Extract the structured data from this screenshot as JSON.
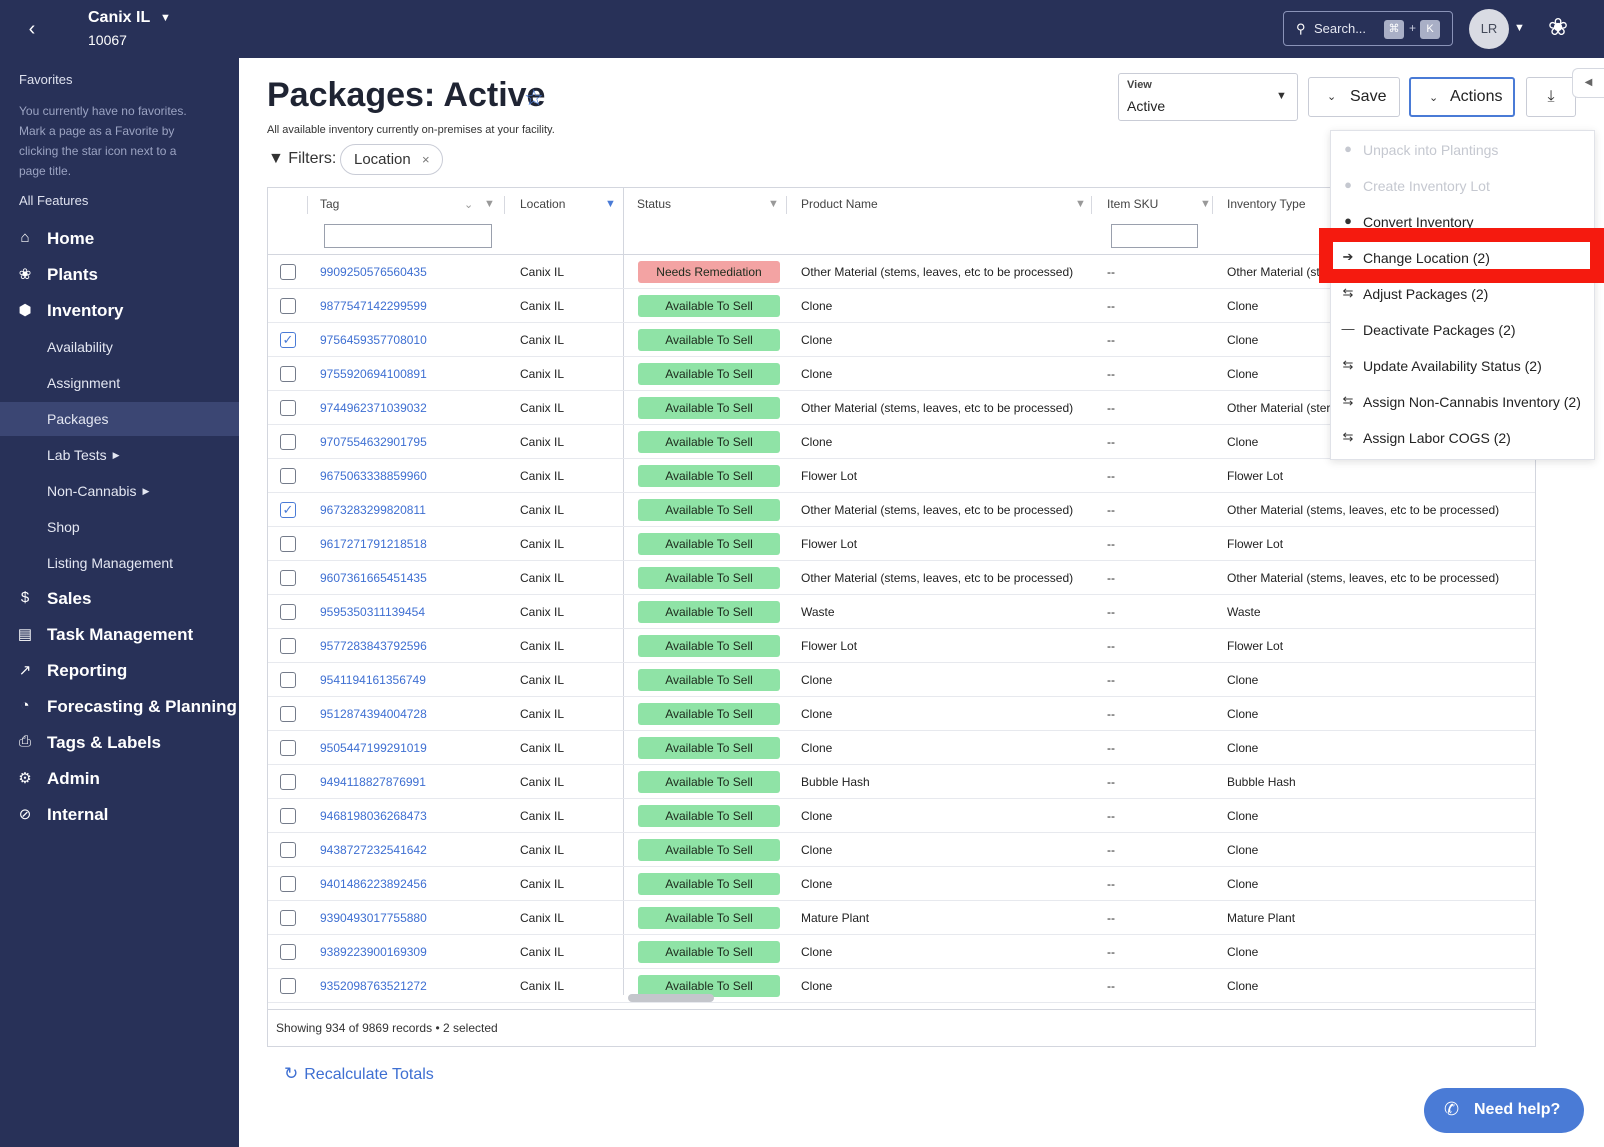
{
  "topbar": {
    "facility_name": "Canix IL",
    "facility_id": "10067",
    "search_placeholder": "Search...",
    "shortcut_keys": [
      "⌘",
      "K"
    ],
    "shortcut_plus": "+",
    "avatar_initials": "LR"
  },
  "sidebar": {
    "favorites_heading": "Favorites",
    "favorites_note": "You currently have no favorites. Mark a page as a Favorite by clicking the star icon next to a page title.",
    "all_features_heading": "All Features",
    "items": [
      {
        "label": "Home",
        "icon": "home-icon",
        "sub": false
      },
      {
        "label": "Plants",
        "icon": "leaf-icon",
        "sub": false
      },
      {
        "label": "Inventory",
        "icon": "box-icon",
        "sub": false
      },
      {
        "label": "Availability",
        "sub": true
      },
      {
        "label": "Assignment",
        "sub": true
      },
      {
        "label": "Packages",
        "sub": true,
        "active": true
      },
      {
        "label": "Lab Tests",
        "sub": true,
        "arrow": true
      },
      {
        "label": "Non-Cannabis",
        "sub": true,
        "arrow": true
      },
      {
        "label": "Shop",
        "sub": true
      },
      {
        "label": "Listing Management",
        "sub": true
      },
      {
        "label": "Sales",
        "icon": "dollar-icon",
        "sub": false
      },
      {
        "label": "Task Management",
        "icon": "clipboard-icon",
        "sub": false
      },
      {
        "label": "Reporting",
        "icon": "trend-icon",
        "sub": false
      },
      {
        "label": "Forecasting & Planning",
        "icon": "clock-icon",
        "sub": false
      },
      {
        "label": "Tags & Labels",
        "icon": "printer-icon",
        "sub": false
      },
      {
        "label": "Admin",
        "icon": "gear-icon",
        "sub": false
      },
      {
        "label": "Internal",
        "icon": "eye-slash-icon",
        "sub": false
      }
    ]
  },
  "page": {
    "title": "Packages: Active",
    "subtitle": "All available inventory currently on-premises at your facility.",
    "filters_label": "Filters:",
    "filter_chip": "Location",
    "view_label": "View",
    "view_value": "Active",
    "save_label": "Save",
    "actions_label": "Actions",
    "recalc_label": "Recalculate Totals",
    "help_label": "Need help?"
  },
  "table": {
    "columns": [
      "Tag",
      "Location",
      "Status",
      "Product Name",
      "Item SKU",
      "Inventory Type"
    ],
    "rows": [
      {
        "tag": "9909250576560435",
        "location": "Canix IL",
        "status": "Needs Remediation",
        "product": "Other Material (stems, leaves, etc to be processed)",
        "sku": "--",
        "type": "Other Material (ste",
        "checked": false
      },
      {
        "tag": "9877547142299599",
        "location": "Canix IL",
        "status": "Available To Sell",
        "product": "Clone",
        "sku": "--",
        "type": "Clone",
        "checked": false
      },
      {
        "tag": "9756459357708010",
        "location": "Canix IL",
        "status": "Available To Sell",
        "product": "Clone",
        "sku": "--",
        "type": "Clone",
        "checked": true
      },
      {
        "tag": "9755920694100891",
        "location": "Canix IL",
        "status": "Available To Sell",
        "product": "Clone",
        "sku": "--",
        "type": "Clone",
        "checked": false
      },
      {
        "tag": "9744962371039032",
        "location": "Canix IL",
        "status": "Available To Sell",
        "product": "Other Material (stems, leaves, etc to be processed)",
        "sku": "--",
        "type": "Other Material (ster",
        "checked": false
      },
      {
        "tag": "9707554632901795",
        "location": "Canix IL",
        "status": "Available To Sell",
        "product": "Clone",
        "sku": "--",
        "type": "Clone",
        "checked": false
      },
      {
        "tag": "9675063338859960",
        "location": "Canix IL",
        "status": "Available To Sell",
        "product": "Flower Lot",
        "sku": "--",
        "type": "Flower Lot",
        "checked": false
      },
      {
        "tag": "9673283299820811",
        "location": "Canix IL",
        "status": "Available To Sell",
        "product": "Other Material (stems, leaves, etc to be processed)",
        "sku": "--",
        "type": "Other Material (stems, leaves, etc to be processed)",
        "checked": true
      },
      {
        "tag": "9617271791218518",
        "location": "Canix IL",
        "status": "Available To Sell",
        "product": "Flower Lot",
        "sku": "--",
        "type": "Flower Lot",
        "checked": false
      },
      {
        "tag": "9607361665451435",
        "location": "Canix IL",
        "status": "Available To Sell",
        "product": "Other Material (stems, leaves, etc to be processed)",
        "sku": "--",
        "type": "Other Material (stems, leaves, etc to be processed)",
        "checked": false
      },
      {
        "tag": "9595350311139454",
        "location": "Canix IL",
        "status": "Available To Sell",
        "product": "Waste",
        "sku": "--",
        "type": "Waste",
        "checked": false
      },
      {
        "tag": "9577283843792596",
        "location": "Canix IL",
        "status": "Available To Sell",
        "product": "Flower Lot",
        "sku": "--",
        "type": "Flower Lot",
        "checked": false
      },
      {
        "tag": "9541194161356749",
        "location": "Canix IL",
        "status": "Available To Sell",
        "product": "Clone",
        "sku": "--",
        "type": "Clone",
        "checked": false
      },
      {
        "tag": "9512874394004728",
        "location": "Canix IL",
        "status": "Available To Sell",
        "product": "Clone",
        "sku": "--",
        "type": "Clone",
        "checked": false
      },
      {
        "tag": "9505447199291019",
        "location": "Canix IL",
        "status": "Available To Sell",
        "product": "Clone",
        "sku": "--",
        "type": "Clone",
        "checked": false
      },
      {
        "tag": "9494118827876991",
        "location": "Canix IL",
        "status": "Available To Sell",
        "product": "Bubble Hash",
        "sku": "--",
        "type": "Bubble Hash",
        "checked": false
      },
      {
        "tag": "9468198036268473",
        "location": "Canix IL",
        "status": "Available To Sell",
        "product": "Clone",
        "sku": "--",
        "type": "Clone",
        "checked": false
      },
      {
        "tag": "9438727232541642",
        "location": "Canix IL",
        "status": "Available To Sell",
        "product": "Clone",
        "sku": "--",
        "type": "Clone",
        "checked": false
      },
      {
        "tag": "9401486223892456",
        "location": "Canix IL",
        "status": "Available To Sell",
        "product": "Clone",
        "sku": "--",
        "type": "Clone",
        "checked": false
      },
      {
        "tag": "9390493017755880",
        "location": "Canix IL",
        "status": "Available To Sell",
        "product": "Mature Plant",
        "sku": "--",
        "type": "Mature Plant",
        "checked": false
      },
      {
        "tag": "9389223900169309",
        "location": "Canix IL",
        "status": "Available To Sell",
        "product": "Clone",
        "sku": "--",
        "type": "Clone",
        "checked": false
      },
      {
        "tag": "9352098763521272",
        "location": "Canix IL",
        "status": "Available To Sell",
        "product": "Clone",
        "sku": "--",
        "type": "Clone",
        "checked": false
      }
    ],
    "footer": "Showing 934 of 9869 records • 2 selected"
  },
  "actions_menu": {
    "items": [
      {
        "label": "Unpack into Plantings",
        "icon": "unpack-icon",
        "disabled": true
      },
      {
        "label": "Create Inventory Lot",
        "icon": "lot-icon",
        "disabled": true
      },
      {
        "label": "Convert Inventory",
        "icon": "convert-icon",
        "disabled": false
      },
      {
        "label": "Change Location (2)",
        "icon": "arrow-right-icon",
        "disabled": false,
        "highlighted": true
      },
      {
        "label": "Adjust Packages (2)",
        "icon": "swap-icon",
        "disabled": false
      },
      {
        "label": "Deactivate Packages (2)",
        "icon": "minus-icon",
        "disabled": false
      },
      {
        "label": "Update Availability Status (2)",
        "icon": "swap-icon",
        "disabled": false
      },
      {
        "label": "Assign Non-Cannabis Inventory (2)",
        "icon": "swap-icon",
        "disabled": false
      },
      {
        "label": "Assign Labor COGS (2)",
        "icon": "swap-icon",
        "disabled": false
      }
    ]
  },
  "colors": {
    "nav_bg": "#283158",
    "accent": "#4a7bd6",
    "status_ok": "#8fe3a6",
    "status_warn": "#f3a3a3",
    "highlight": "#f51a0f"
  }
}
